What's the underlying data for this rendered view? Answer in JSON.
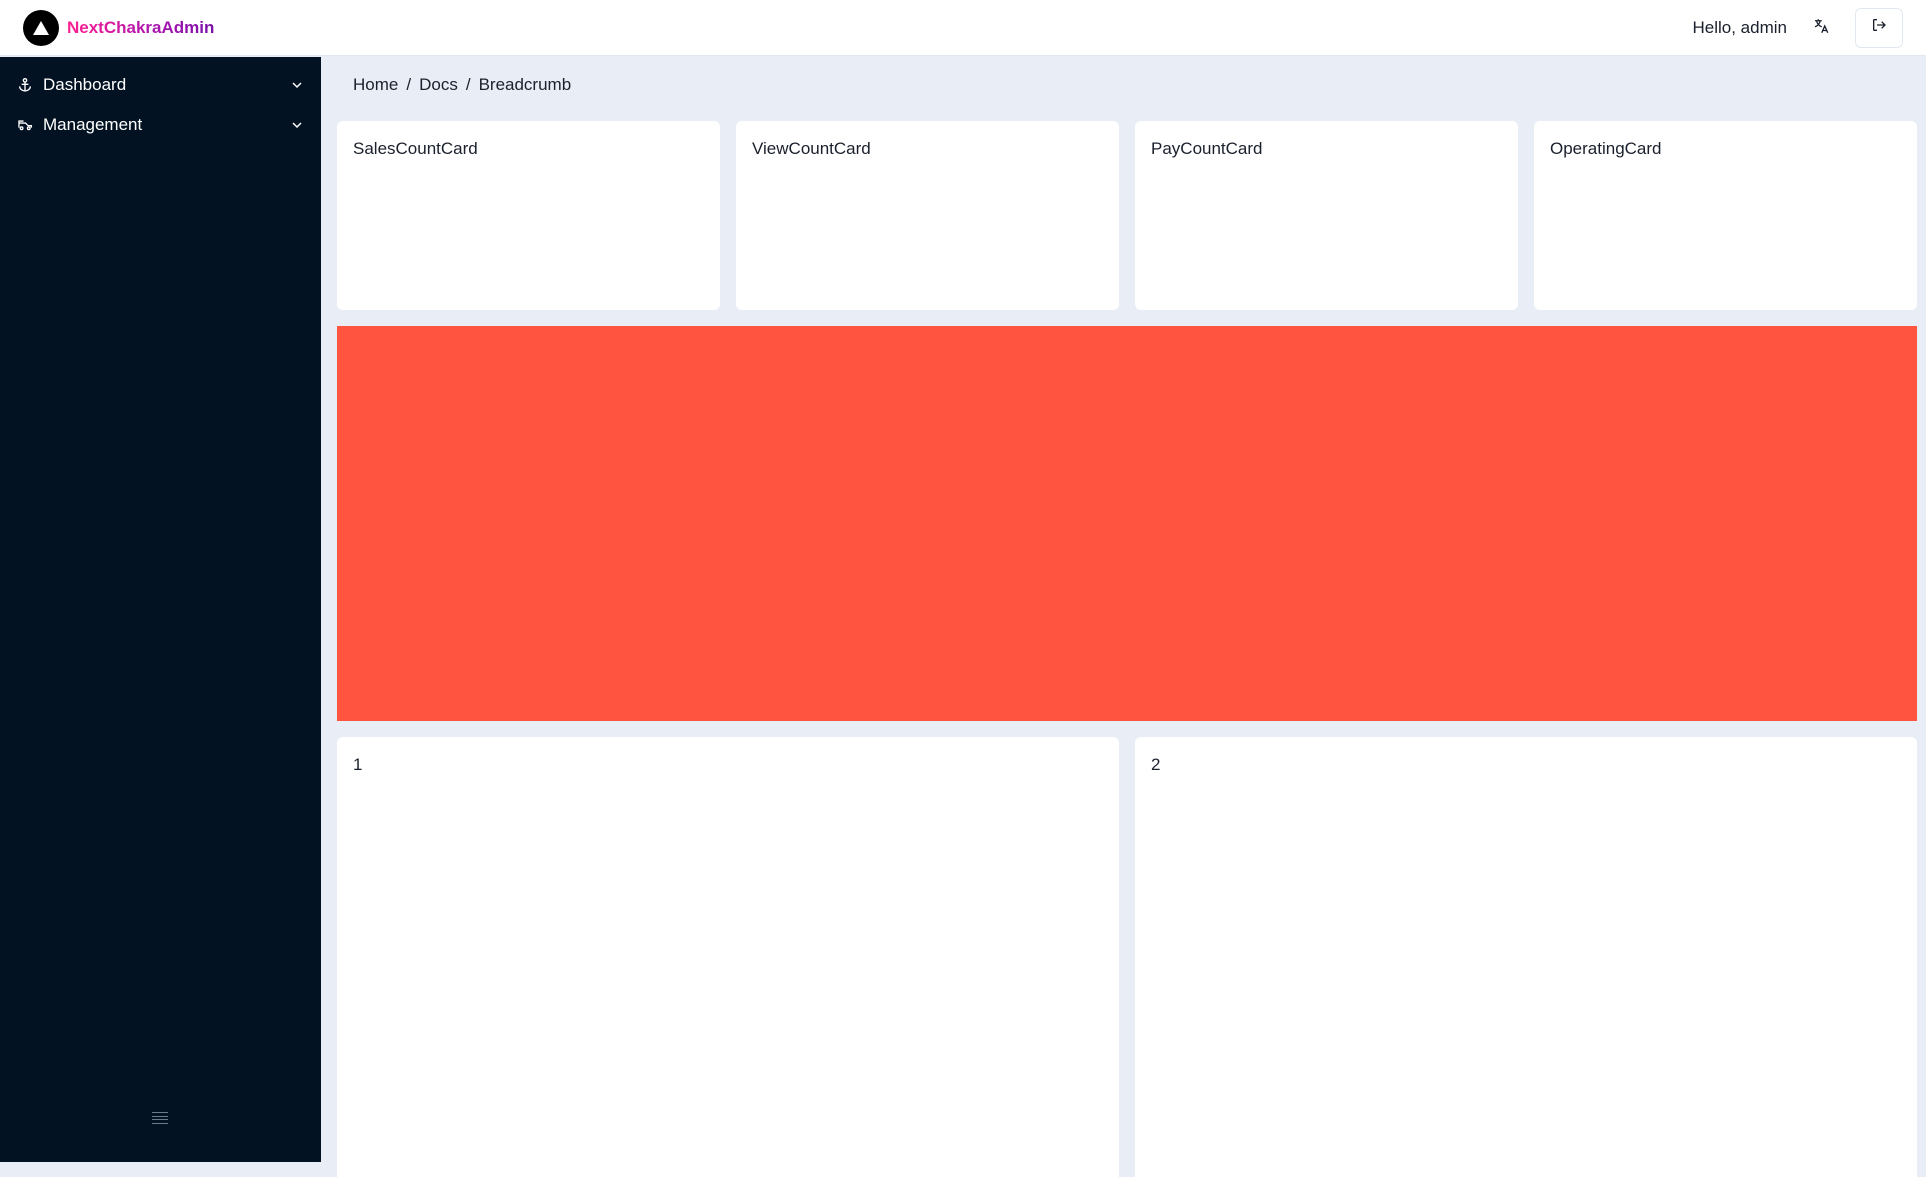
{
  "app": {
    "brand": "NextChakraAdmin",
    "greeting": "Hello, admin"
  },
  "icons": {
    "logo": "triangle-logo-icon",
    "language": "translate-icon",
    "logout": "logout-icon",
    "dashboard": "anchor-icon",
    "management": "car-icon",
    "chevron": "chevron-down-icon",
    "collapse": "menu-lines-icon"
  },
  "sidebar": {
    "items": [
      {
        "label": "Dashboard"
      },
      {
        "label": "Management"
      }
    ]
  },
  "breadcrumb": {
    "items": [
      "Home",
      "Docs",
      "Breadcrumb"
    ],
    "separator": "/"
  },
  "stat_cards": [
    {
      "title": "SalesCountCard"
    },
    {
      "title": "ViewCountCard"
    },
    {
      "title": "PayCountCard"
    },
    {
      "title": "OperatingCard"
    }
  ],
  "panels": [
    {
      "title": "1"
    },
    {
      "title": "2"
    }
  ],
  "colors": {
    "sidebar_bg": "#021222",
    "page_bg": "#e9eef6",
    "banner": "#ff5540",
    "brand_gradient_start": "#ff1f8f",
    "brand_gradient_end": "#7a0fa8"
  }
}
